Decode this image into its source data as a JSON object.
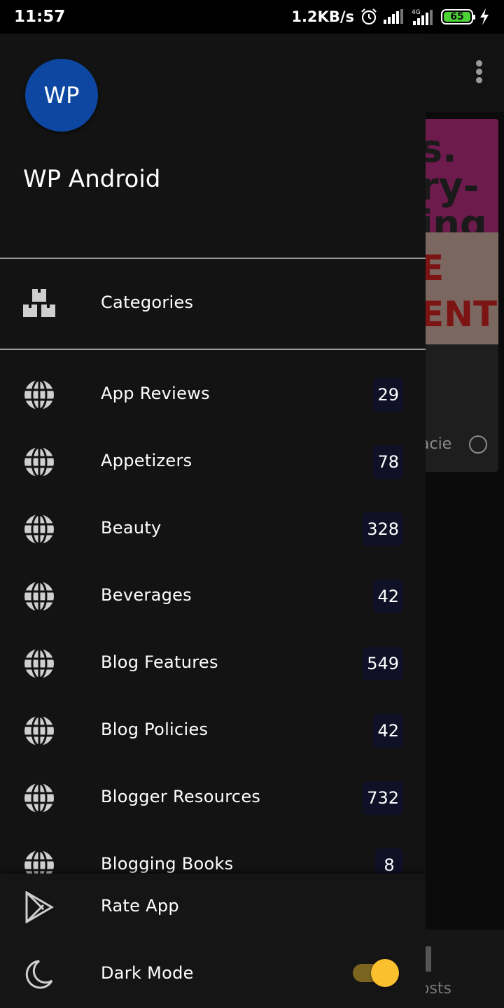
{
  "status_bar": {
    "time": "11:57",
    "net_speed": "1.2KB/s",
    "network_type": "4G",
    "battery": "65",
    "icons": [
      "alarm-icon",
      "signal-icon",
      "signal-4g-icon",
      "battery-icon",
      "charging-icon"
    ]
  },
  "background": {
    "toolbar_menu_icon": "more-vertical-icon",
    "card_image_top_text": "s. ry- ing",
    "card_image_bottom_text": "E ENT ENT",
    "card_author": "acie",
    "bottom_nav_label": "osts"
  },
  "drawer": {
    "avatar_text": "WP",
    "app_name": "WP Android",
    "categories_header": {
      "label": "Categories",
      "icon": "categories-icon"
    },
    "items": [
      {
        "label": "App Reviews",
        "count": "29"
      },
      {
        "label": "Appetizers",
        "count": "78"
      },
      {
        "label": "Beauty",
        "count": "328"
      },
      {
        "label": "Beverages",
        "count": "42"
      },
      {
        "label": "Blog Features",
        "count": "549"
      },
      {
        "label": "Blog Policies",
        "count": "42"
      },
      {
        "label": "Blogger Resources",
        "count": "732"
      },
      {
        "label": "Blogging Books",
        "count": "8"
      }
    ],
    "item_icon": "globe-icon",
    "footer": {
      "rate": {
        "label": "Rate App",
        "icon": "play-store-icon"
      },
      "dark_mode": {
        "label": "Dark Mode",
        "icon": "moon-icon",
        "enabled": true
      }
    }
  },
  "colors": {
    "drawer_bg": "#131313",
    "avatar_bg": "#0d47a1",
    "count_bg": "#101026",
    "toggle_thumb": "#fbc02d",
    "toggle_track": "#7a6420",
    "battery_fill": "#4cd137"
  }
}
